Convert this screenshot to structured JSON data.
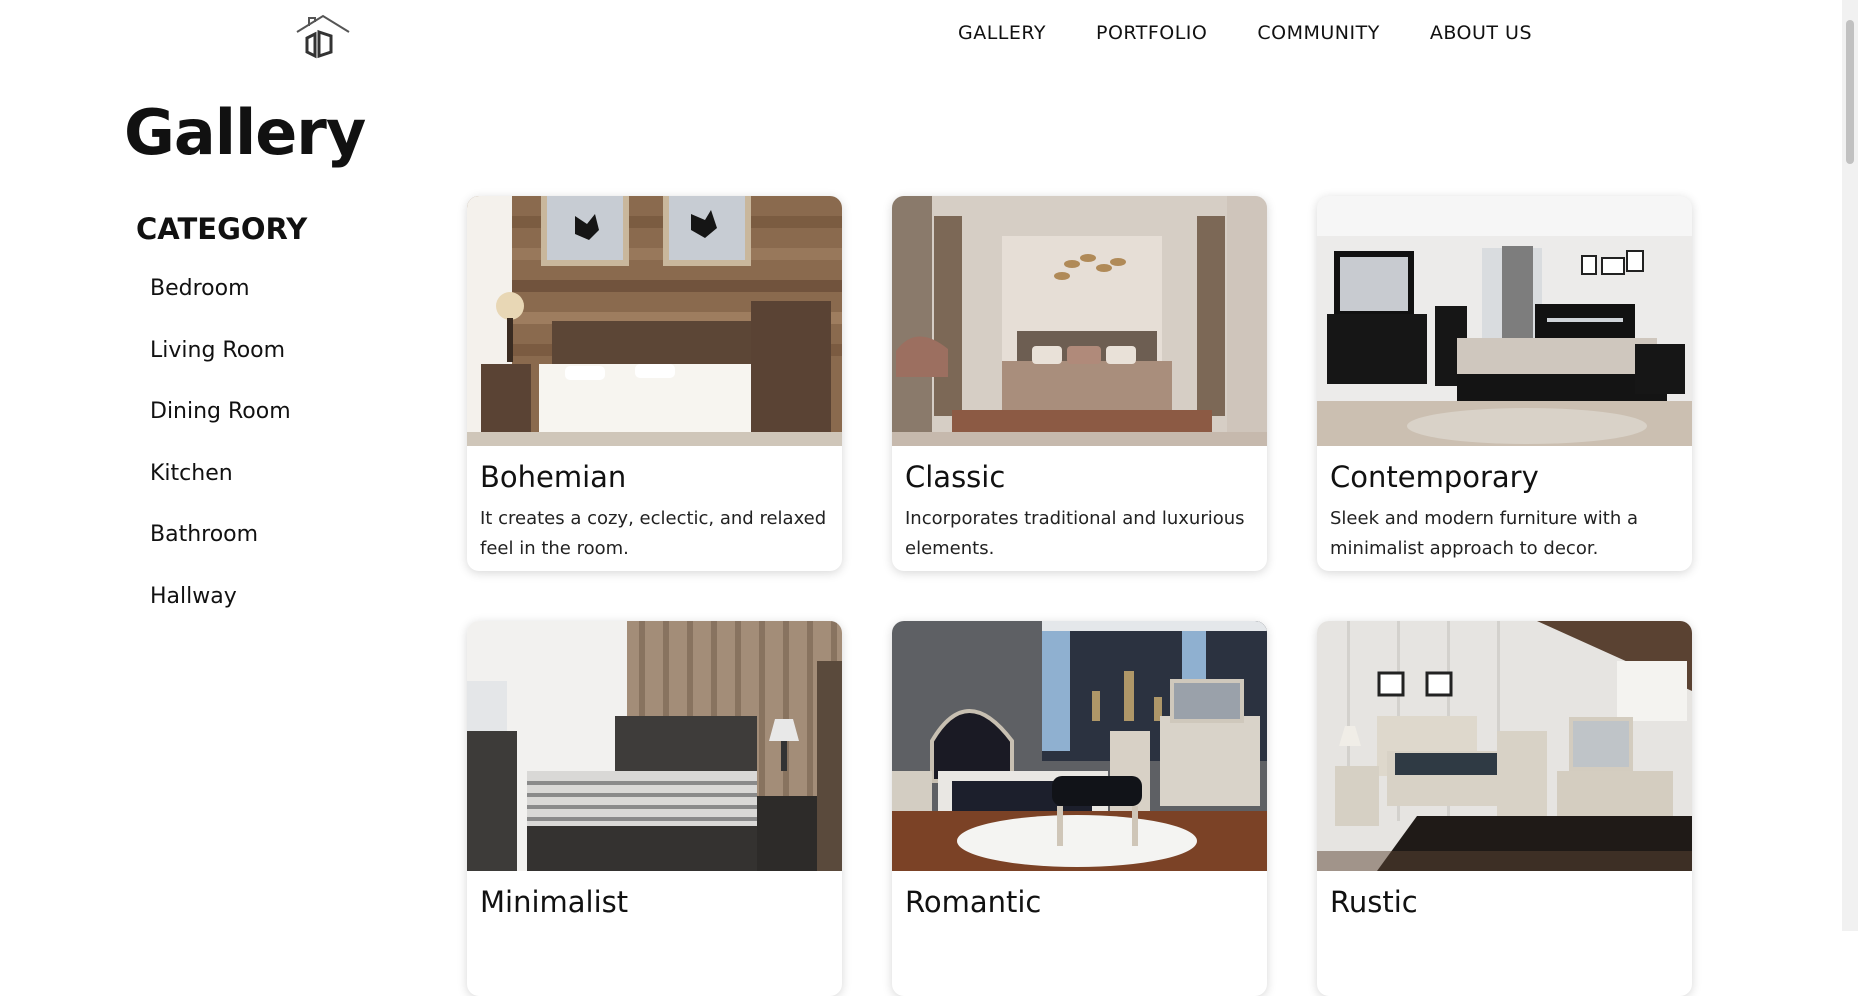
{
  "nav": {
    "items": [
      {
        "label": "GALLERY"
      },
      {
        "label": "PORTFOLIO"
      },
      {
        "label": "COMMUNITY"
      },
      {
        "label": "ABOUT US"
      }
    ]
  },
  "page": {
    "title": "Gallery"
  },
  "sidebar": {
    "heading": "CATEGORY",
    "items": [
      {
        "label": "Bedroom"
      },
      {
        "label": "Living Room"
      },
      {
        "label": "Dining Room"
      },
      {
        "label": "Kitchen"
      },
      {
        "label": "Bathroom"
      },
      {
        "label": "Hallway"
      }
    ]
  },
  "cards": [
    {
      "title": "Bohemian",
      "description": "It creates a cozy, eclectic, and relaxed feel in the room."
    },
    {
      "title": "Classic",
      "description": "Incorporates traditional and luxurious elements."
    },
    {
      "title": "Contemporary",
      "description": "Sleek and modern furniture with a minimalist approach to decor."
    },
    {
      "title": "Minimalist",
      "description": ""
    },
    {
      "title": "Romantic",
      "description": ""
    },
    {
      "title": "Rustic",
      "description": ""
    }
  ],
  "icons": {
    "logo": "house-logo-icon"
  }
}
